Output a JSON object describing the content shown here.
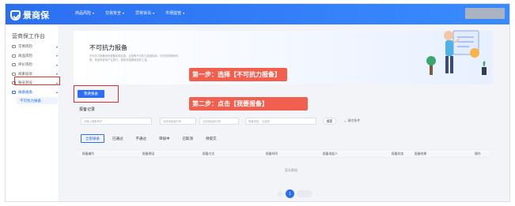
{
  "brand": {
    "name": "景商保"
  },
  "topnav": [
    {
      "label": "商品风险"
    },
    {
      "label": "交易安全"
    },
    {
      "label": "异常诉讼"
    },
    {
      "label": "市场监管"
    }
  ],
  "sidebar": {
    "title": "营商保工作台",
    "items": [
      {
        "label": "交易风险",
        "icon": "trade-icon"
      },
      {
        "label": "商品风险",
        "icon": "goods-icon"
      },
      {
        "label": "评价风险",
        "icon": "review-icon"
      },
      {
        "label": "商家投诉",
        "icon": "complaint-icon"
      },
      {
        "label": "账号封号",
        "icon": "account-icon"
      },
      {
        "label": "报备报备",
        "icon": "report-icon"
      }
    ],
    "active_sub": "不可抗力报备"
  },
  "hero": {
    "title": "不可抗力报备",
    "desc": "不可抗力报备用来报备影响交易、交易等不可抗力原因影响，可在相关期间内报，商品商家用产生损行，保险流保报用品的工具。"
  },
  "callouts": {
    "step1": "第一步：选择【不可抗力报备】",
    "step2": "第二步：点击【我要报备】"
  },
  "report_button": "我要报备",
  "records_title": "报备记录",
  "filters": {
    "f1": "请输入报备单号",
    "f2": "请选择起始时间",
    "f3": "请选择结束时间",
    "f4": "报备原因",
    "f4_value": "请选择",
    "search": "搜索",
    "clear": "清空条件"
  },
  "tabs": [
    "全部报备",
    "已通过",
    "不通过",
    "审核中",
    "已取消",
    "待提交"
  ],
  "table": {
    "headers": [
      "报备编号",
      "报备原因",
      "报备方式",
      "报备时间",
      "报备发起人",
      "报备状态",
      "报备结果",
      "操作"
    ],
    "empty": "暂无数据"
  },
  "pager": {
    "current": "1"
  }
}
